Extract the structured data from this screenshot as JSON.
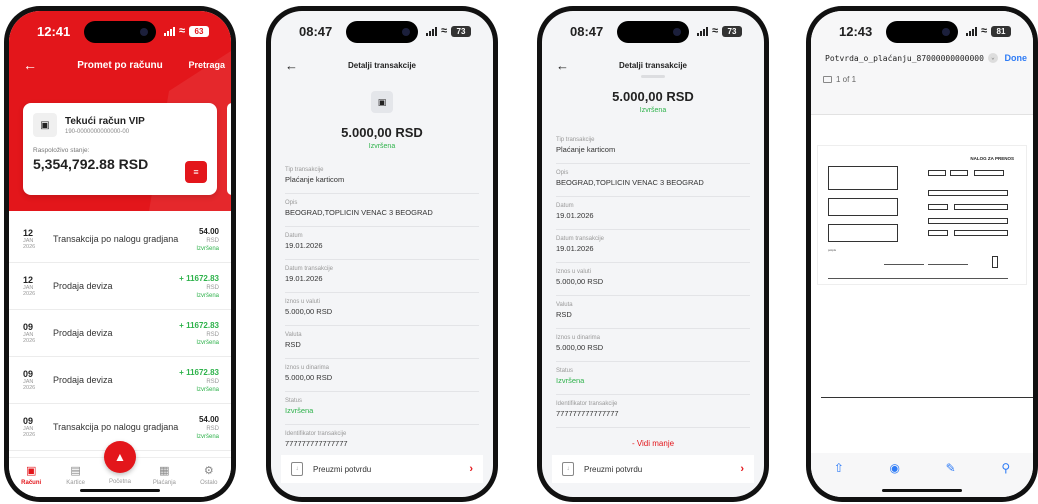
{
  "phone1": {
    "status": {
      "time": "12:41",
      "battery": "63"
    },
    "nav": {
      "title": "Promet po računu",
      "search": "Pretraga"
    },
    "account": {
      "name": "Tekući račun VIP",
      "number": "190-0000000000000-00",
      "balance_label": "Raspoloživo stanje:",
      "balance": "5,354,792.88 RSD"
    },
    "transactions": [
      {
        "day": "12",
        "month": "JAN",
        "year": "2026",
        "title": "Transakcija po nalogu gradjana",
        "amount": "54.00",
        "currency": "RSD",
        "status": "Izvršena",
        "positive": false
      },
      {
        "day": "12",
        "month": "JAN",
        "year": "2026",
        "title": "Prodaja deviza",
        "amount": "+ 11672.83",
        "currency": "RSD",
        "status": "Izvršena",
        "positive": true
      },
      {
        "day": "09",
        "month": "JAN",
        "year": "2026",
        "title": "Prodaja deviza",
        "amount": "+ 11672.83",
        "currency": "RSD",
        "status": "Izvršena",
        "positive": true
      },
      {
        "day": "09",
        "month": "JAN",
        "year": "2026",
        "title": "Prodaja deviza",
        "amount": "+ 11672.83",
        "currency": "RSD",
        "status": "Izvršena",
        "positive": true
      },
      {
        "day": "09",
        "month": "JAN",
        "year": "2026",
        "title": "Transakcija po nalogu gradjana",
        "amount": "54.00",
        "currency": "RSD",
        "status": "Izvršena",
        "positive": false
      }
    ],
    "tabs": [
      {
        "label": "Računi",
        "icon": "wallet-icon",
        "active": true
      },
      {
        "label": "Kartice",
        "icon": "card-icon",
        "active": false
      },
      {
        "label": "Početna",
        "icon": "home-icon",
        "active": false
      },
      {
        "label": "Plaćanja",
        "icon": "payments-icon",
        "active": false
      },
      {
        "label": "Ostalo",
        "icon": "settings-icon",
        "active": false
      }
    ],
    "colors": {
      "brand": "#e3161b",
      "success": "#2eb24b"
    }
  },
  "phone2": {
    "status": {
      "time": "08:47",
      "battery": "73"
    },
    "title": "Detalji transakcije",
    "amount": "5.000,00 RSD",
    "status_text": "Izvršena",
    "fields": [
      {
        "label": "Tip transakcije",
        "value": "Plaćanje karticom"
      },
      {
        "label": "Opis",
        "value": "BEOGRAD,TOPLICIN VENAC 3   BEOGRAD"
      },
      {
        "label": "Datum",
        "value": "19.01.2026"
      },
      {
        "label": "Datum transakcije",
        "value": "19.01.2026"
      },
      {
        "label": "Iznos u valuti",
        "value": "5.000,00 RSD"
      },
      {
        "label": "Valuta",
        "value": "RSD"
      },
      {
        "label": "Iznos u dinarima",
        "value": "5.000,00 RSD"
      },
      {
        "label": "Status",
        "value": "Izvršena"
      },
      {
        "label": "Identifikator transakcije",
        "value": "777777777777777"
      }
    ],
    "download": "Preuzmi potvrdu"
  },
  "phone3": {
    "status": {
      "time": "08:47",
      "battery": "73"
    },
    "title": "Detalji transakcije",
    "amount": "5.000,00 RSD",
    "status_text": "Izvršena",
    "fields": [
      {
        "label": "Tip transakcije",
        "value": "Plaćanje karticom"
      },
      {
        "label": "Opis",
        "value": "BEOGRAD,TOPLICIN VENAC 3   BEOGRAD"
      },
      {
        "label": "Datum",
        "value": "19.01.2026"
      },
      {
        "label": "Datum transakcije",
        "value": "19.01.2026"
      },
      {
        "label": "Iznos u valuti",
        "value": "5.000,00 RSD"
      },
      {
        "label": "Valuta",
        "value": "RSD"
      },
      {
        "label": "Iznos u dinarima",
        "value": "5.000,00 RSD"
      },
      {
        "label": "Status",
        "value": "Izvršena"
      },
      {
        "label": "Identifikator transakcije",
        "value": "777777777777777"
      }
    ],
    "see_less": "- Vidi manje",
    "download": "Preuzmi potvrdu"
  },
  "phone4": {
    "status": {
      "time": "12:43",
      "battery": "81"
    },
    "file_name": "Potvrda_o_plaćanju_87000000000000",
    "done": "Done",
    "page_count": "1 of 1",
    "form_title": "NALOG ZA PRENOS",
    "tools": [
      "share-icon",
      "markup-icon",
      "signature-icon",
      "search-icon"
    ],
    "colors": {
      "ios_blue": "#2f7cf6"
    }
  }
}
